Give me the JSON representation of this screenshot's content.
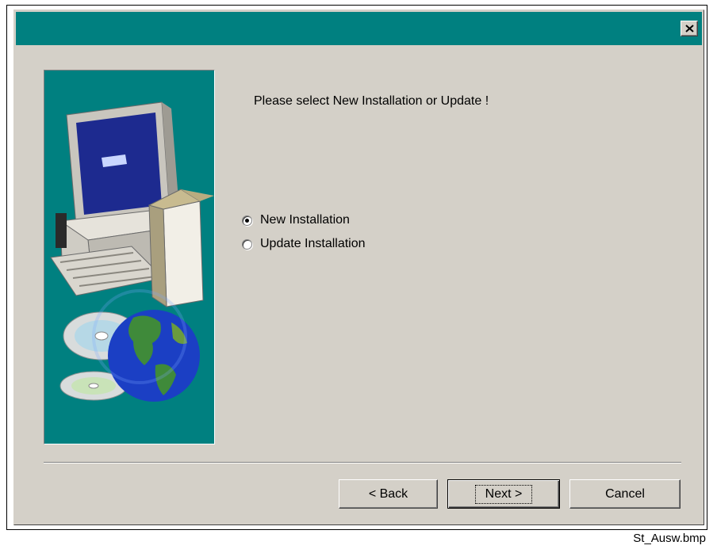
{
  "dialog": {
    "prompt": "Please select New Installation or Update !",
    "options": [
      {
        "label": "New Installation",
        "checked": true
      },
      {
        "label": "Update Installation",
        "checked": false
      }
    ],
    "buttons": {
      "back": "< Back",
      "next": "Next >",
      "cancel": "Cancel"
    }
  },
  "caption": "St_Ausw.bmp",
  "colors": {
    "titlebar": "#008080",
    "panel": "#008080",
    "face": "#d4d0c8"
  },
  "icons": [
    "close-icon",
    "computer-illustration",
    "cd-disc-icon",
    "globe-icon"
  ]
}
